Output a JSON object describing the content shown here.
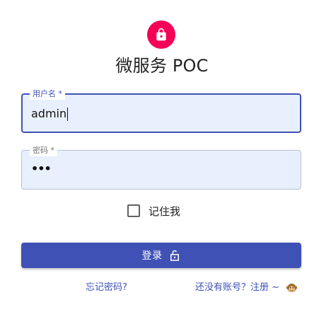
{
  "app": {
    "title": "微服务 POC"
  },
  "form": {
    "username": {
      "label": "用户名 *",
      "value": "admin"
    },
    "password": {
      "label": "密码 *",
      "value_masked": "•••"
    },
    "remember": {
      "label": "记住我",
      "checked": false
    },
    "login_button": {
      "label": "登录"
    }
  },
  "links": {
    "forgot_password": "忘记密码?",
    "register": "还没有账号？注册 ~"
  },
  "colors": {
    "accent": "#3f51b5",
    "avatar_bg": "#f50057",
    "field_bg": "#e8f0fe"
  },
  "icons": {
    "avatar": "lock-icon",
    "login": "lock-open-icon",
    "register": "monkey-emoji-icon"
  }
}
